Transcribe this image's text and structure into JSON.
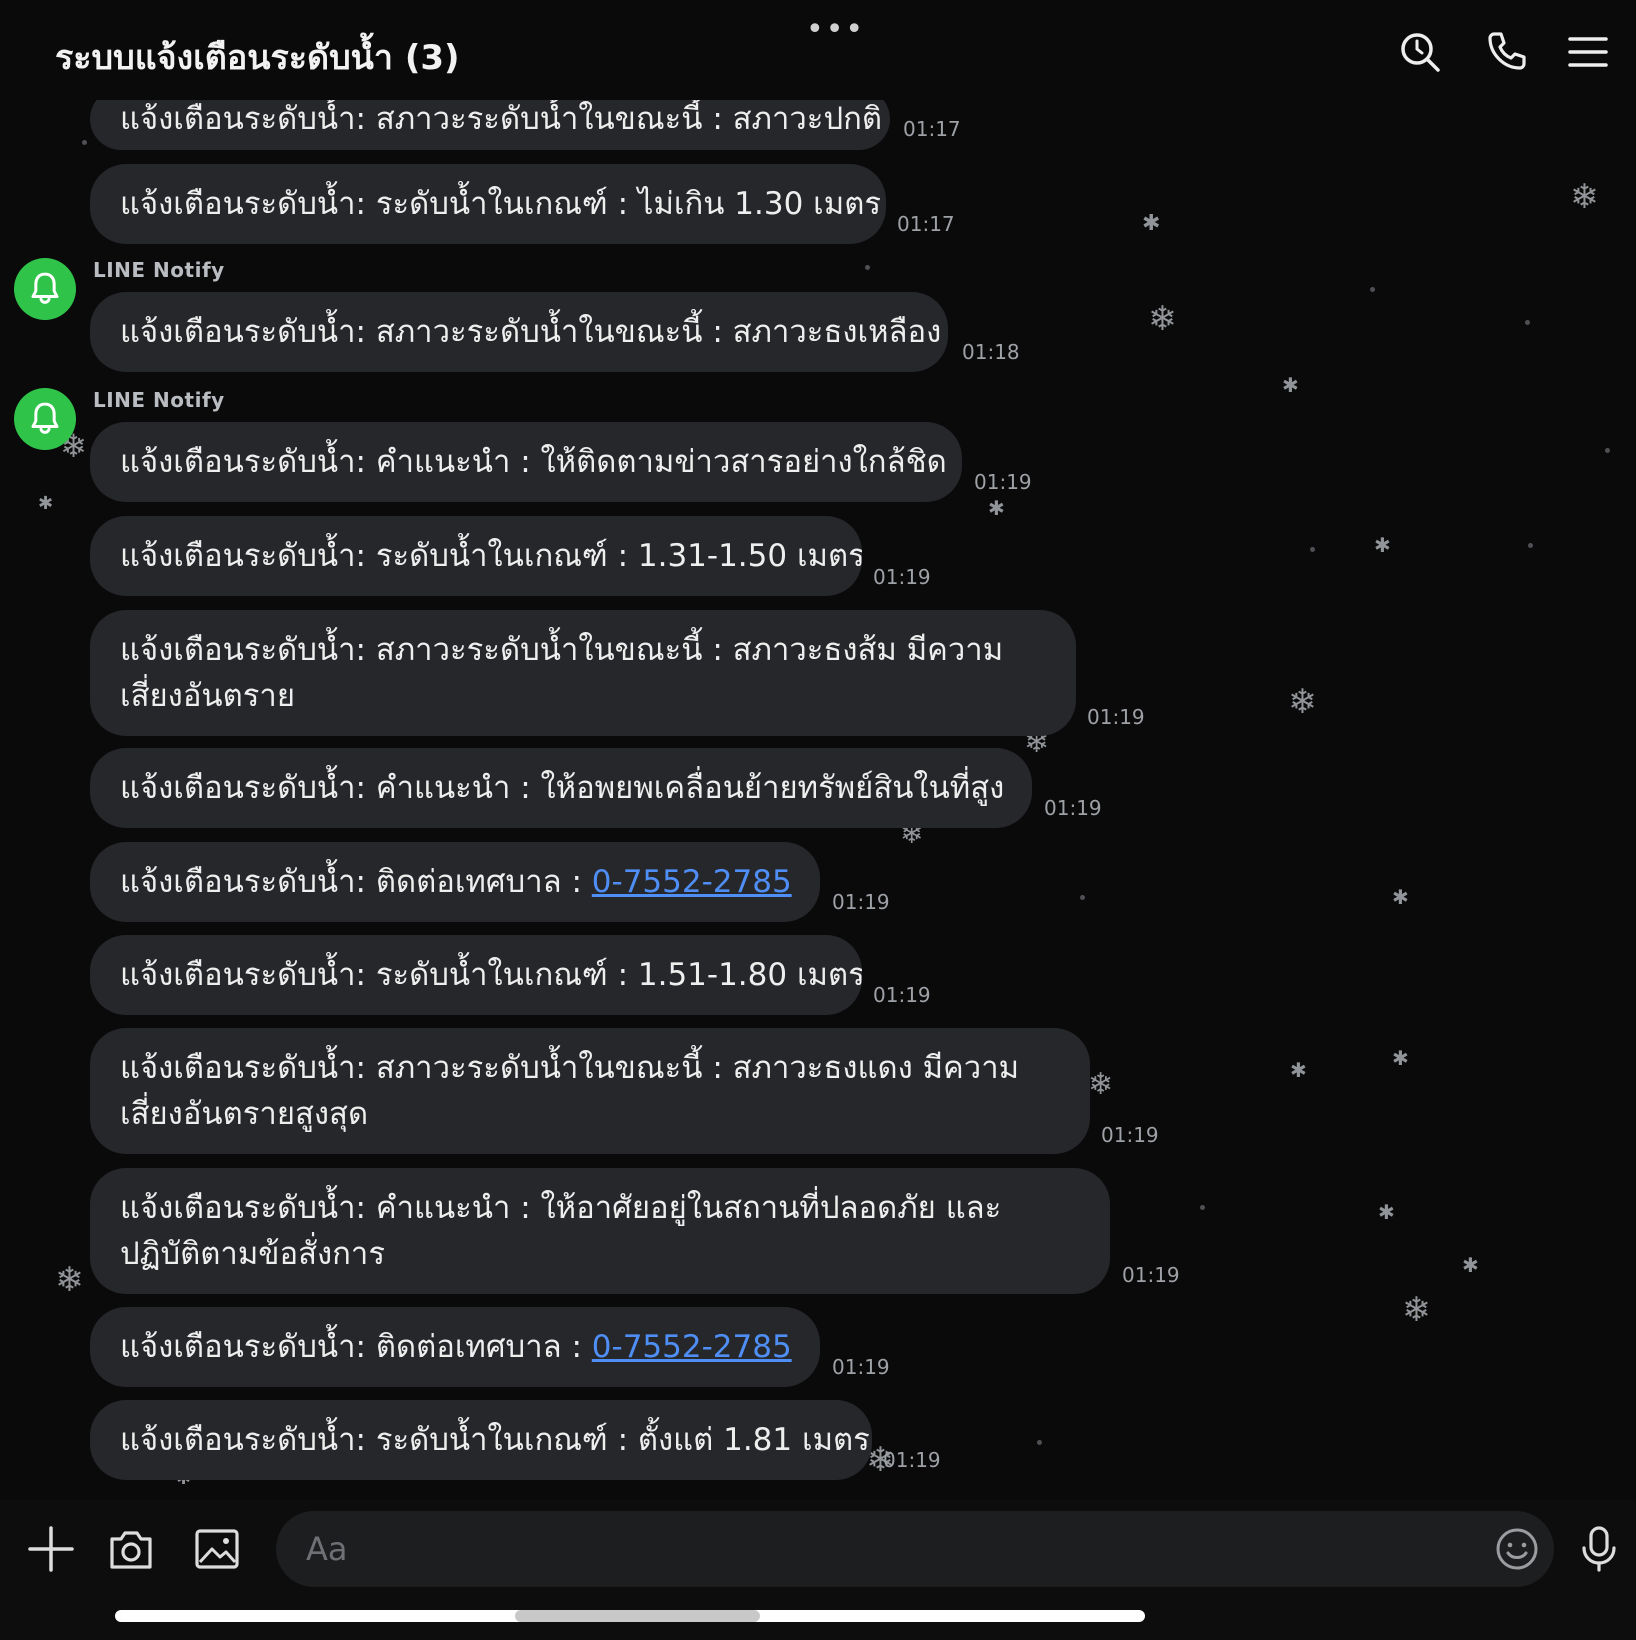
{
  "header": {
    "title": "ระบบแจ้งเตือนระดับน้ำ (3)",
    "more_dots": "•••",
    "icons": [
      "search-icon",
      "phone-icon",
      "menu-icon"
    ]
  },
  "messages": {
    "sender": "LINE Notify",
    "prefix": "แจ้งเตือนระดับน้ำ: ",
    "phone": "0-7552-2785",
    "m0": {
      "text": "แจ้งเตือนระดับน้ำ: สภาวะระดับน้ำในขณะนี้ : สภาวะปกติ",
      "time": "01:17"
    },
    "m1": {
      "text": "แจ้งเตือนระดับน้ำ: ระดับน้ำในเกณฑ์ : ไม่เกิน 1.30 เมตร",
      "time": "01:17"
    },
    "m2": {
      "text": "แจ้งเตือนระดับน้ำ: สภาวะระดับน้ำในขณะนี้ : สภาวะธงเหลือง",
      "time": "01:18"
    },
    "m3": {
      "text": "แจ้งเตือนระดับน้ำ: คำแนะนำ : ให้ติดตามข่าวสารอย่างใกล้ชิด",
      "time": "01:19"
    },
    "m4": {
      "text": "แจ้งเตือนระดับน้ำ: ระดับน้ำในเกณฑ์ : 1.31-1.50 เมตร",
      "time": "01:19"
    },
    "m5": {
      "text": "แจ้งเตือนระดับน้ำ: สภาวะระดับน้ำในขณะนี้ : สภาวะธงส้ม มีความเสี่ยงอันตราย",
      "time": "01:19"
    },
    "m6": {
      "text": "แจ้งเตือนระดับน้ำ: คำแนะนำ : ให้อพยพเคลื่อนย้ายทรัพย์สินในที่สูง",
      "time": "01:19"
    },
    "m7": {
      "text": "แจ้งเตือนระดับน้ำ: ติดต่อเทศบาล : ",
      "time": "01:19"
    },
    "m8": {
      "text": "แจ้งเตือนระดับน้ำ: ระดับน้ำในเกณฑ์ : 1.51-1.80 เมตร",
      "time": "01:19"
    },
    "m9": {
      "text": "แจ้งเตือนระดับน้ำ: สภาวะระดับน้ำในขณะนี้ : สภาวะธงแดง มีความเสี่ยงอันตรายสูงสุด",
      "time": "01:19"
    },
    "m10": {
      "text": "แจ้งเตือนระดับน้ำ: คำแนะนำ : ให้อาศัยอยู่ในสถานที่ปลอดภัย และปฏิบัติตามข้อสั่งการ",
      "time": "01:19"
    },
    "m11": {
      "text": "แจ้งเตือนระดับน้ำ: ติดต่อเทศบาล : ",
      "time": "01:19"
    },
    "m12": {
      "text": "แจ้งเตือนระดับน้ำ: ระดับน้ำในเกณฑ์ : ตั้งแต่ 1.81 เมตร",
      "time": "01:19"
    }
  },
  "input": {
    "placeholder": "Aa"
  },
  "icons": {
    "avatar": "bell-icon",
    "bottom": [
      "plus-icon",
      "camera-icon",
      "image-icon",
      "emoji-icon",
      "microphone-icon"
    ]
  },
  "colors": {
    "background": "#0a0a0b",
    "bubble": "#26272a",
    "avatar_green": "#2fc34a",
    "link_blue": "#4f8ef5"
  }
}
